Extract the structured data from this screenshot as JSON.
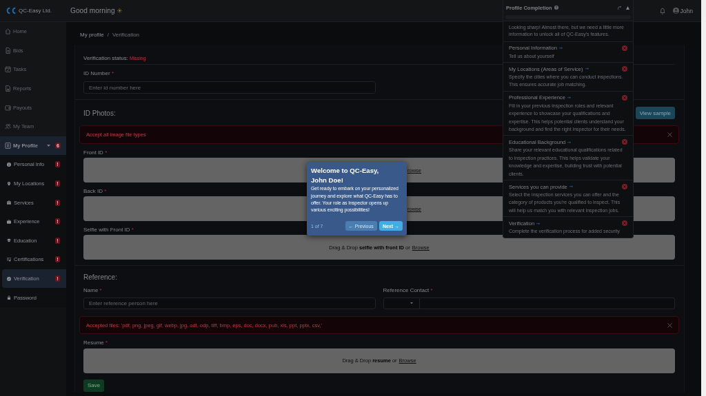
{
  "sidebar": {
    "brand": "QC-Easy Ltd.",
    "items": [
      {
        "label": "Home",
        "selected": false,
        "disabled": true
      },
      {
        "label": "Bids",
        "selected": false,
        "disabled": true
      },
      {
        "label": "Tasks",
        "selected": false,
        "disabled": true
      },
      {
        "label": "Reports",
        "selected": false,
        "disabled": true
      },
      {
        "label": "Payouts",
        "selected": false,
        "disabled": true
      },
      {
        "label": "My Team",
        "selected": false,
        "disabled": true
      },
      {
        "label": "My Profile",
        "selected": true,
        "disabled": false,
        "expanded": true,
        "badge": "6",
        "children": [
          {
            "label": "Personal Info",
            "badge": "!",
            "selected": false
          },
          {
            "label": "My Locations",
            "badge": "!",
            "selected": false
          },
          {
            "label": "Services",
            "badge": "!",
            "selected": false
          },
          {
            "label": "Experience",
            "badge": "!",
            "selected": false
          },
          {
            "label": "Education",
            "badge": "!",
            "selected": false
          },
          {
            "label": "Certifications",
            "badge": "!",
            "selected": false
          },
          {
            "label": "Verification",
            "badge": "!",
            "selected": true
          },
          {
            "label": "Password",
            "selected": false
          }
        ]
      }
    ]
  },
  "header": {
    "greeting": "Good morning",
    "user_name": "John"
  },
  "breadcrumb": {
    "items": [
      "My profile",
      "Verification"
    ],
    "separator": "/"
  },
  "verification": {
    "status_label": "Verification status:",
    "status": "Missing",
    "id_number": {
      "label": "ID Number",
      "required_mark": "*",
      "placeholder": "Enter id number here"
    }
  },
  "id_photos": {
    "title": "ID Photos:",
    "sample_button": "View sample",
    "alert": "Accept all image file types",
    "uploads": [
      {
        "label": "Front ID",
        "required_mark": "*",
        "kind": "covered",
        "link": "rowse"
      },
      {
        "label": "Back ID",
        "required_mark": "*",
        "kind": "covered",
        "link": "rowse"
      },
      {
        "label": "Selfie with Front ID",
        "required_mark": "*",
        "kind": "full",
        "hint": "Drag & Drop **selfie with front ID** or",
        "link": "Browse"
      }
    ]
  },
  "reference": {
    "title": "Reference:",
    "name": {
      "label": "Name",
      "required_mark": "*",
      "placeholder": "Enter reference person here"
    },
    "contact": {
      "label": "Reference Contact",
      "required_mark": "*"
    },
    "alert": "Accepted files: 'pdf, png, jpeg, gif, webp, jpg, odt, odp, tiff, bmp, eps, doc, docx, pub, xls, ppt, pptx, csv,'",
    "resume": {
      "label": "Resume",
      "required_mark": "*",
      "kind": "full",
      "hint": "Drag & Drop **resume** or",
      "link": "Browse"
    },
    "save_button": "Save"
  },
  "profile_completion": {
    "title": "Profile Completion",
    "level": 0,
    "intro": "Looking sharp! Almost there, but we need a little more information to unlock all of QC-Easy's features.",
    "steps": [
      {
        "title": "Personal Information",
        "description": "Tell us about yourself",
        "complete": false
      },
      {
        "title": "My Locations (Areas of Service)",
        "description": "Specify the cities where you can conduct inspections. This ensures accurate job matching.",
        "complete": false
      },
      {
        "title": "Professional Experience",
        "description": "Fill in your previous inspection roles and relevant experience to showcase your qualifications and expertise. This helps potential clients understand your background and find the right inspector for their needs.",
        "complete": false
      },
      {
        "title": "Educational Background",
        "description": "Share your relevant educational qualifications related to inspection practices. This helps validate your knowledge and expertise, building trust with potential clients.",
        "complete": false
      },
      {
        "title": "Services you can provide",
        "description": "Select the inspection services you can offer and the category of products you're qualified to inspect. This will help us match you with relevant inspection jobs.",
        "complete": false
      },
      {
        "title": "Verification",
        "description": "Complete the verification process for added security",
        "complete": false
      }
    ]
  },
  "tour": {
    "title": "Welcome to QC-Easy, John Doe!",
    "body": "Get ready to embark on your personalized journey and explore what QC-Easy has to offer. Your role as Inspector opens up various exciting possibilities!",
    "step": "1 of 7",
    "buttons": [
      {
        "label": "← Previous",
        "disabled": true
      },
      {
        "label": "Next →",
        "disabled": false
      }
    ]
  }
}
